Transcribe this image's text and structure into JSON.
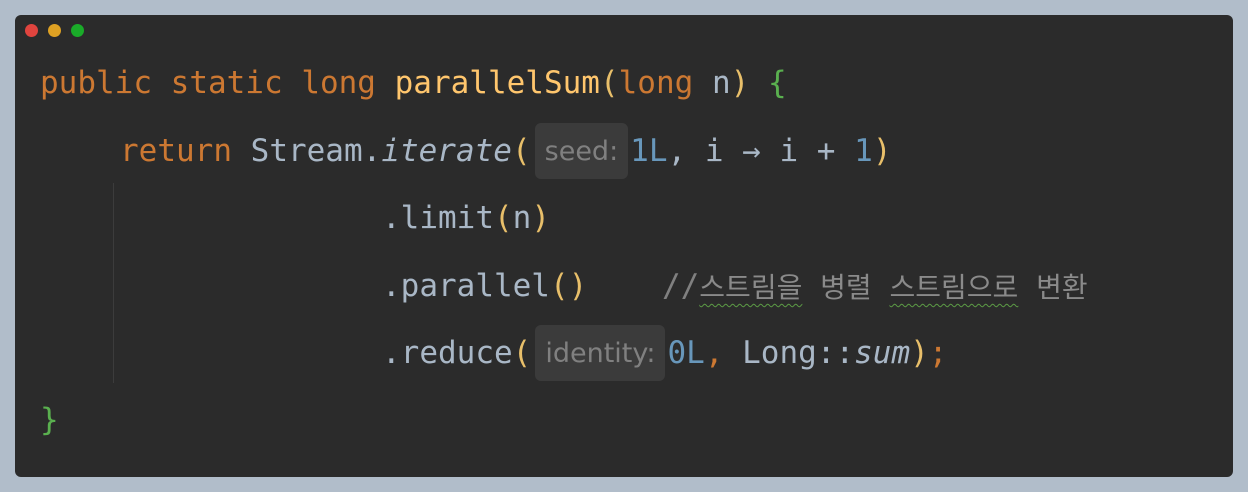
{
  "window_controls": {
    "colors": {
      "close": "#e0443e",
      "minimize": "#dea123",
      "maximize": "#1aab29"
    }
  },
  "code": {
    "line1": {
      "kw_public": "public",
      "kw_static": "static",
      "kw_long": "long",
      "method": "parallelSum",
      "paren_open": "(",
      "param_type": "long",
      "param_name": "n",
      "paren_close": ")",
      "brace": "{"
    },
    "line2": {
      "kw_return": "return",
      "class": "Stream.",
      "method": "iterate",
      "paren_open": "(",
      "hint": "seed:",
      "seed_value": "1L",
      "rest": ", i → i + ",
      "one": "1",
      "paren_close": ")"
    },
    "line3": {
      "prefix": ".limit",
      "paren_open": "(",
      "arg": "n",
      "paren_close": ")"
    },
    "line4": {
      "prefix": ".parallel",
      "parens": "()",
      "comment_slashes": "//",
      "comment_w1": "스트림을",
      "comment_w2": "병렬",
      "comment_w3": "스트림으로",
      "comment_w4": "변환"
    },
    "line5": {
      "prefix": ".reduce",
      "paren_open": "(",
      "hint": "identity:",
      "identity_value": "0L",
      "comma": ", ",
      "ref_class": "Long::",
      "ref_method": "sum",
      "paren_close": ")",
      "semicolon": ";"
    },
    "line6": {
      "brace": "}"
    }
  }
}
